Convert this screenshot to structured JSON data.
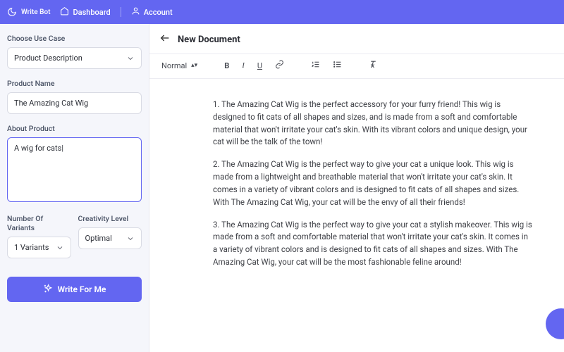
{
  "brand": {
    "name": "Write Bot"
  },
  "nav": {
    "dashboard": "Dashboard",
    "account": "Account"
  },
  "sidebar": {
    "useCaseLabel": "Choose Use Case",
    "useCaseValue": "Product Description",
    "productNameLabel": "Product Name",
    "productNameValue": "The Amazing Cat Wig",
    "aboutLabel": "About Product",
    "aboutValue": "A wig for cats|",
    "variantsLabel": "Number Of Variants",
    "variantsValue": "1 Variants",
    "creativityLabel": "Creativity Level",
    "creativityValue": "Optimal",
    "ctaLabel": "Write For Me"
  },
  "doc": {
    "title": "New Document",
    "formatLabel": "Normal"
  },
  "output": {
    "p1": "1. The Amazing Cat Wig is the perfect accessory for your furry friend! This wig is designed to fit cats of all shapes and sizes, and is made from a soft and comfortable material that won't irritate your cat's skin. With its vibrant colors and unique design, your cat will be the talk of the town!",
    "p2": "2. The Amazing Cat Wig is the perfect way to give your cat a unique look. This wig is made from a lightweight and breathable material that won't irritate your cat's skin. It comes in a variety of vibrant colors and is designed to fit cats of all shapes and sizes. With The Amazing Cat Wig, your cat will be the envy of all their friends!",
    "p3": "3. The Amazing Cat Wig is the perfect way to give your cat a stylish makeover. This wig is made from a soft and comfortable material that won't irritate your cat's skin. It comes in a variety of vibrant colors and is designed to fit cats of all shapes and sizes. With The Amazing Cat Wig, your cat will be the most fashionable feline around!"
  },
  "colors": {
    "accent": "#6366f1"
  }
}
